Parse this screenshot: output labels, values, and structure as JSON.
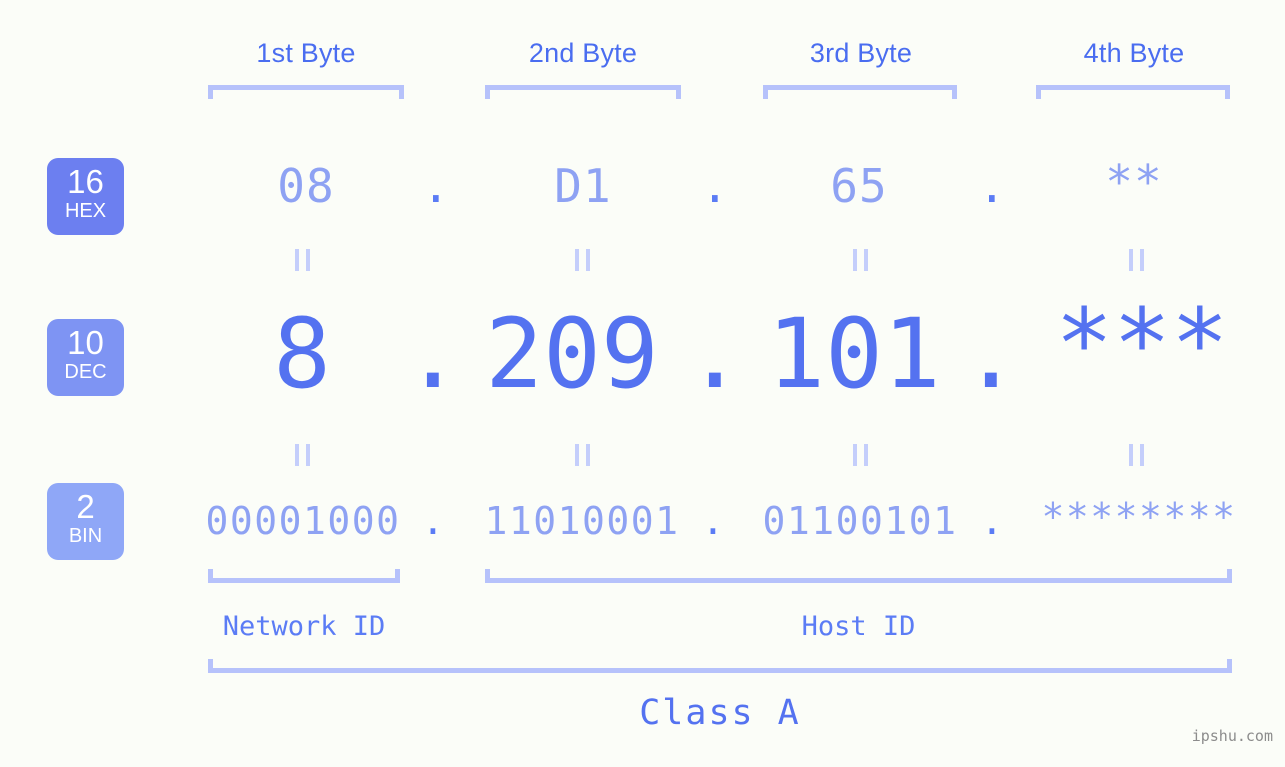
{
  "meta": {
    "background_color": "#fbfdf8",
    "accent_color": "#5472f0",
    "light_accent_color": "#8ea2f3",
    "bracket_color": "#b6c2fb",
    "watermark": "ipshu.com"
  },
  "byte_headers": [
    {
      "label": "1st Byte"
    },
    {
      "label": "2nd Byte"
    },
    {
      "label": "3rd Byte"
    },
    {
      "label": "4th Byte"
    }
  ],
  "bases": [
    {
      "num": "16",
      "name": "HEX",
      "color": "#6c7ff0"
    },
    {
      "num": "10",
      "name": "DEC",
      "color": "#7e94f3"
    },
    {
      "num": "2",
      "name": "BIN",
      "color": "#8fa7f7"
    }
  ],
  "rows": {
    "hex": {
      "values": [
        "08",
        "D1",
        "65",
        "**"
      ],
      "separator": "."
    },
    "dec": {
      "values": [
        "8",
        "209",
        "101",
        "***"
      ],
      "separator": "."
    },
    "bin": {
      "values": [
        "00001000",
        "11010001",
        "01100101",
        "********"
      ],
      "separator": "."
    }
  },
  "equals_sign": "=",
  "id_sections": [
    {
      "label": "Network ID"
    },
    {
      "label": "Host ID"
    }
  ],
  "class_label": "Class A"
}
